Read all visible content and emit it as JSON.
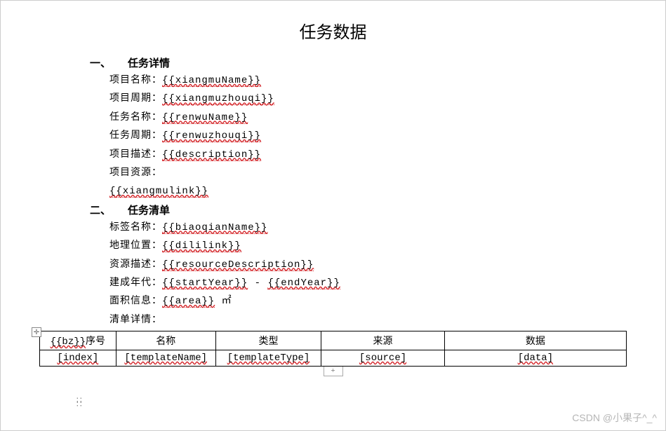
{
  "title": "任务数据",
  "sections": {
    "s1": {
      "num": "一、",
      "title": "任务详情",
      "fields": {
        "projectName": {
          "label": "项目名称：",
          "value": "{{xiangmuName}}"
        },
        "projectCycle": {
          "label": "项目周期：",
          "value": "{{xiangmuzhouqi}}"
        },
        "taskName": {
          "label": "任务名称：",
          "value": "{{renwuName}}"
        },
        "taskCycle": {
          "label": "任务周期：",
          "value": "{{renwuzhouqi}}"
        },
        "description": {
          "label": "项目描述：",
          "value": "{{description}}"
        },
        "resourceLabel": "项目资源：",
        "resourceValue": "{{xiangmulink}}"
      }
    },
    "s2": {
      "num": "二、",
      "title": "任务清单",
      "fields": {
        "tagName": {
          "label": "标签名称：",
          "value": "{{biaoqianName}}"
        },
        "geoLoc": {
          "label": "地理位置：",
          "value": "{{dililink}}"
        },
        "resDesc": {
          "label": "资源描述：",
          "value": "{{resourceDescription}}"
        },
        "builtYear": {
          "label": "建成年代：",
          "value1": "{{startYear}}",
          "sep": " - ",
          "value2": "{{endYear}}"
        },
        "areaInfo": {
          "label": "面积信息：",
          "value": "{{area}}",
          "unit": " ㎡"
        },
        "listDetailLabel": "清单详情："
      }
    }
  },
  "table": {
    "headers": {
      "c1_prefix": "{{bz}}",
      "c1_suffix": "序号",
      "c2": "名称",
      "c3": "类型",
      "c4": "来源",
      "c5": "数据"
    },
    "row": {
      "c1": "[index]",
      "c2": "[templateName]",
      "c3": "[templateType]",
      "c4": "[source]",
      "c5": "[data]"
    }
  },
  "addTab": "+",
  "watermark": "CSDN @小果子^_^"
}
